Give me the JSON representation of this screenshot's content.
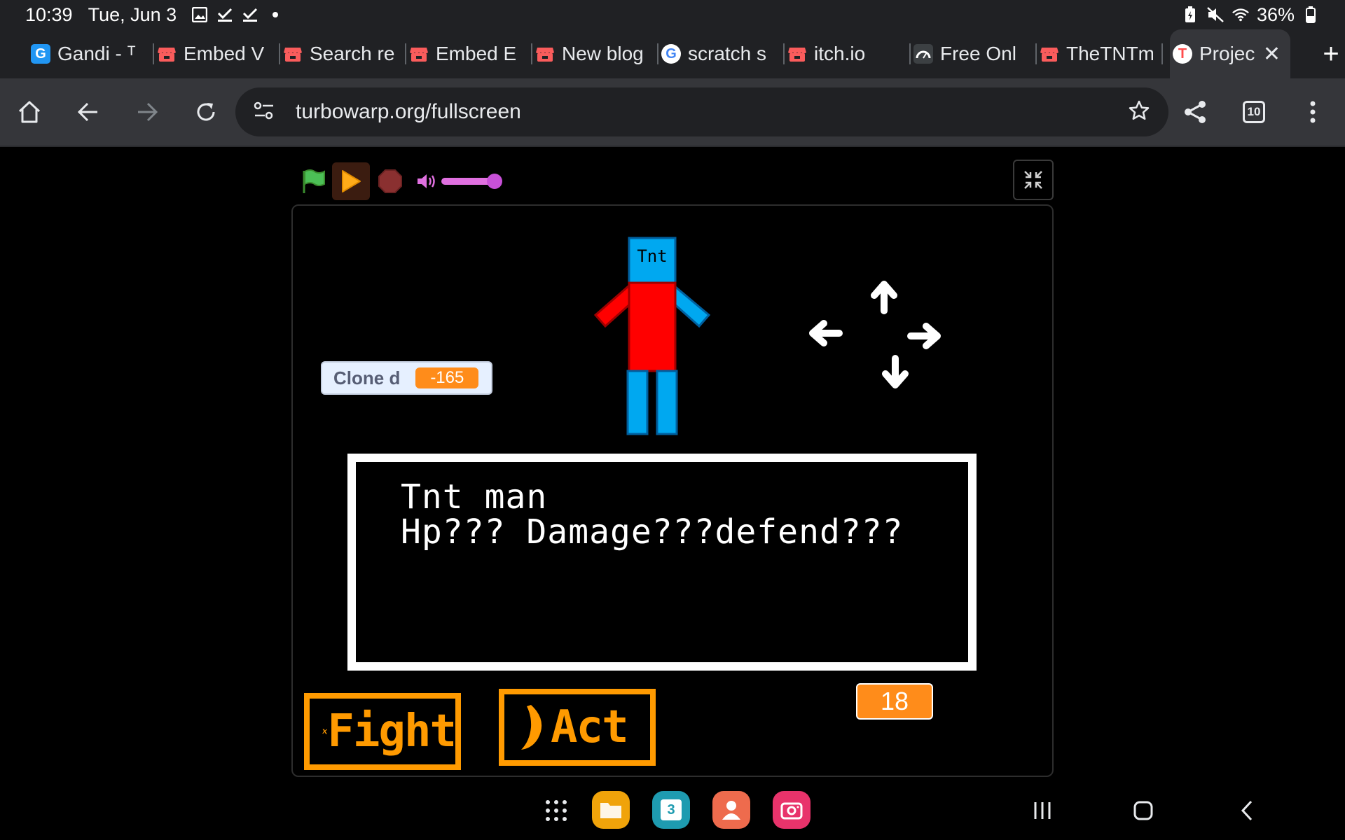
{
  "status_bar": {
    "time": "10:39",
    "date": "Tue, Jun 3",
    "battery": "36%",
    "icons": [
      "image-icon",
      "check-icon",
      "check-icon",
      "dot-icon",
      "battery-saver-icon",
      "mute-icon",
      "wifi-icon",
      "battery-icon"
    ]
  },
  "tabs": [
    {
      "label": "Gandi - ᵀ",
      "favicon": "gandi-icon",
      "color": "#2196f3"
    },
    {
      "label": "Embed V",
      "favicon": "itch-icon",
      "color": "#fa5c5c"
    },
    {
      "label": "Search re",
      "favicon": "itch-icon",
      "color": "#fa5c5c"
    },
    {
      "label": "Embed E",
      "favicon": "itch-icon",
      "color": "#fa5c5c"
    },
    {
      "label": "New blog",
      "favicon": "itch-icon",
      "color": "#fa5c5c"
    },
    {
      "label": "scratch s",
      "favicon": "google-icon",
      "color": "#4285f4"
    },
    {
      "label": "itch.io",
      "favicon": "itch-icon",
      "color": "#fa5c5c"
    },
    {
      "label": "Free Onl",
      "favicon": "speedometer-icon",
      "color": "#9aa0a6"
    },
    {
      "label": "TheTNTm",
      "favicon": "itch-icon",
      "color": "#fa5c5c"
    },
    {
      "label": "Projec",
      "favicon": "turbowarp-icon",
      "color": "#ff4c4c",
      "active": true
    }
  ],
  "toolbar": {
    "url": "turbowarp.org/fullscreen",
    "tab_count": "10"
  },
  "player": {
    "volume_level": 0.85
  },
  "stage": {
    "sprite_label": "Tnt",
    "monitor_label": "Clone d",
    "monitor_value": "-165",
    "dialog_line1": "Tnt man",
    "dialog_line2": "Hp??? Damage???defend???",
    "fight_label": "Fight",
    "act_label": "Act",
    "counter_value": "18"
  },
  "dock": {
    "calendar_day": "3",
    "colors": {
      "files": "#f0a30a",
      "calendar": "#1e9bb0",
      "contacts": "#ee6b4d",
      "camera": "#e8336b"
    }
  }
}
